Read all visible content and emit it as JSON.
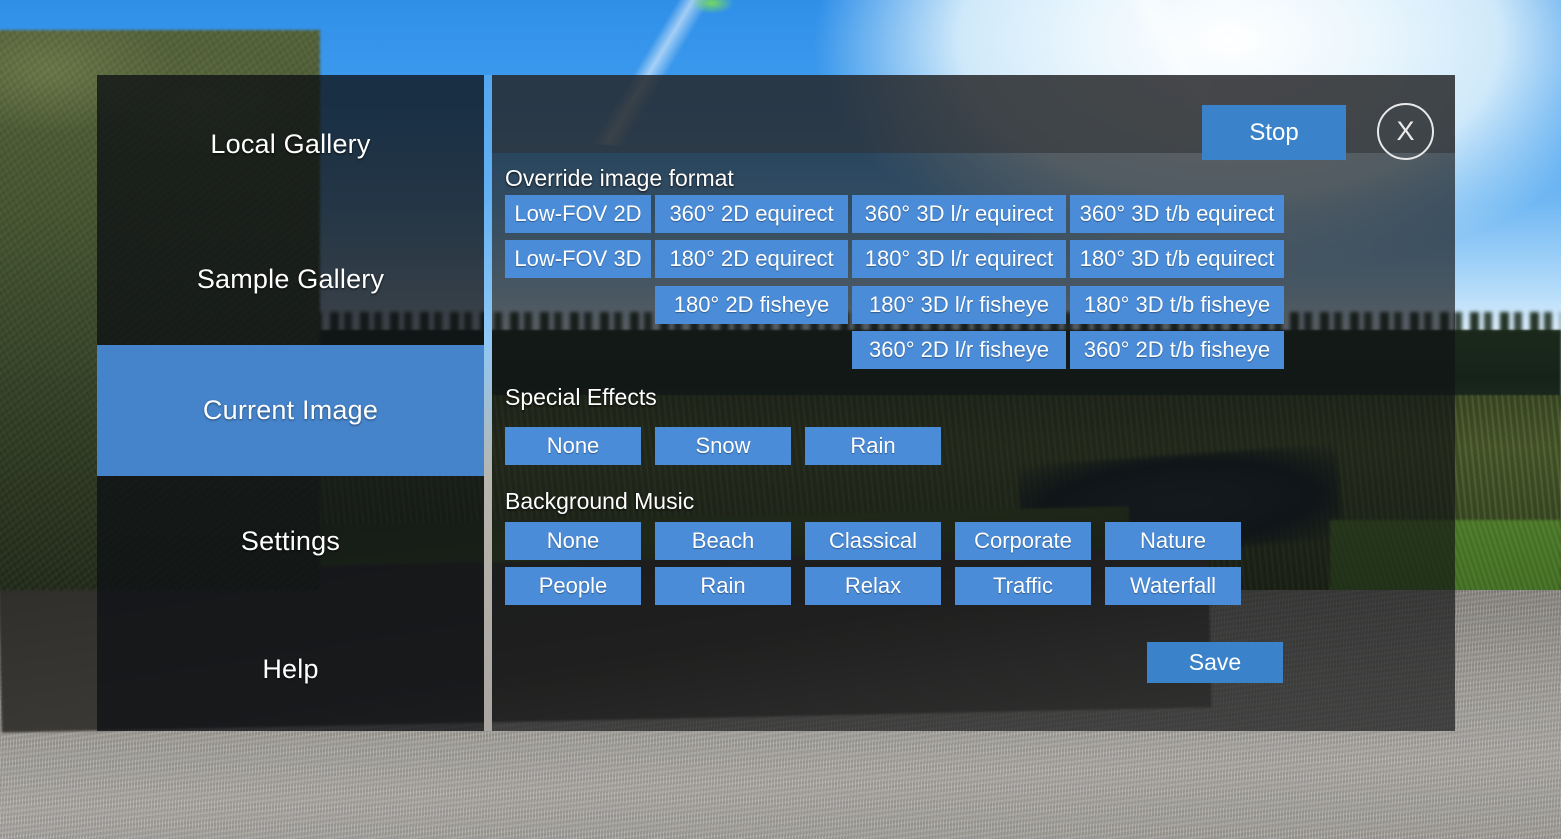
{
  "app": {
    "background_scene": "360-degree outdoor photo: blue sky, trees, meadow, pond and asphalt road"
  },
  "colors": {
    "accent_button": "#4a8cd8",
    "primary_button": "#3a82c9",
    "selected_sidebar": "#498cd8",
    "panel_bg": "rgba(16,18,20,0.66)",
    "sidebar_bg": "rgba(14,17,20,0.78)",
    "text": "#ffffff"
  },
  "sidebar": {
    "items": [
      {
        "label": "Local Gallery",
        "selected": false
      },
      {
        "label": "Sample Gallery",
        "selected": false
      },
      {
        "label": "Current Image",
        "selected": true
      },
      {
        "label": "Settings",
        "selected": false
      },
      {
        "label": "Help",
        "selected": false
      }
    ]
  },
  "panel": {
    "header": {
      "stop_label": "Stop",
      "close_label": "X",
      "close_icon": "close-x-icon"
    },
    "sections": [
      {
        "title": "Override image format",
        "rows": [
          [
            "Low-FOV 2D",
            "360° 2D equirect",
            "360° 3D l/r equirect",
            "360° 3D t/b equirect"
          ],
          [
            "Low-FOV 3D",
            "180° 2D equirect",
            "180° 3D l/r equirect",
            "180° 3D t/b equirect"
          ],
          [
            "",
            "180° 2D fisheye",
            "180° 3D l/r fisheye",
            "180° 3D t/b fisheye"
          ],
          [
            "",
            "",
            "360° 2D l/r fisheye",
            "360° 2D t/b fisheye"
          ]
        ]
      },
      {
        "title": "Special Effects",
        "rows": [
          [
            "None",
            "Snow",
            "Rain"
          ]
        ]
      },
      {
        "title": "Background Music",
        "rows": [
          [
            "None",
            "Beach",
            "Classical",
            "Corporate",
            "Nature"
          ],
          [
            "People",
            "Rain",
            "Relax",
            "Traffic",
            "Waterfall"
          ]
        ]
      }
    ],
    "save_label": "Save"
  }
}
